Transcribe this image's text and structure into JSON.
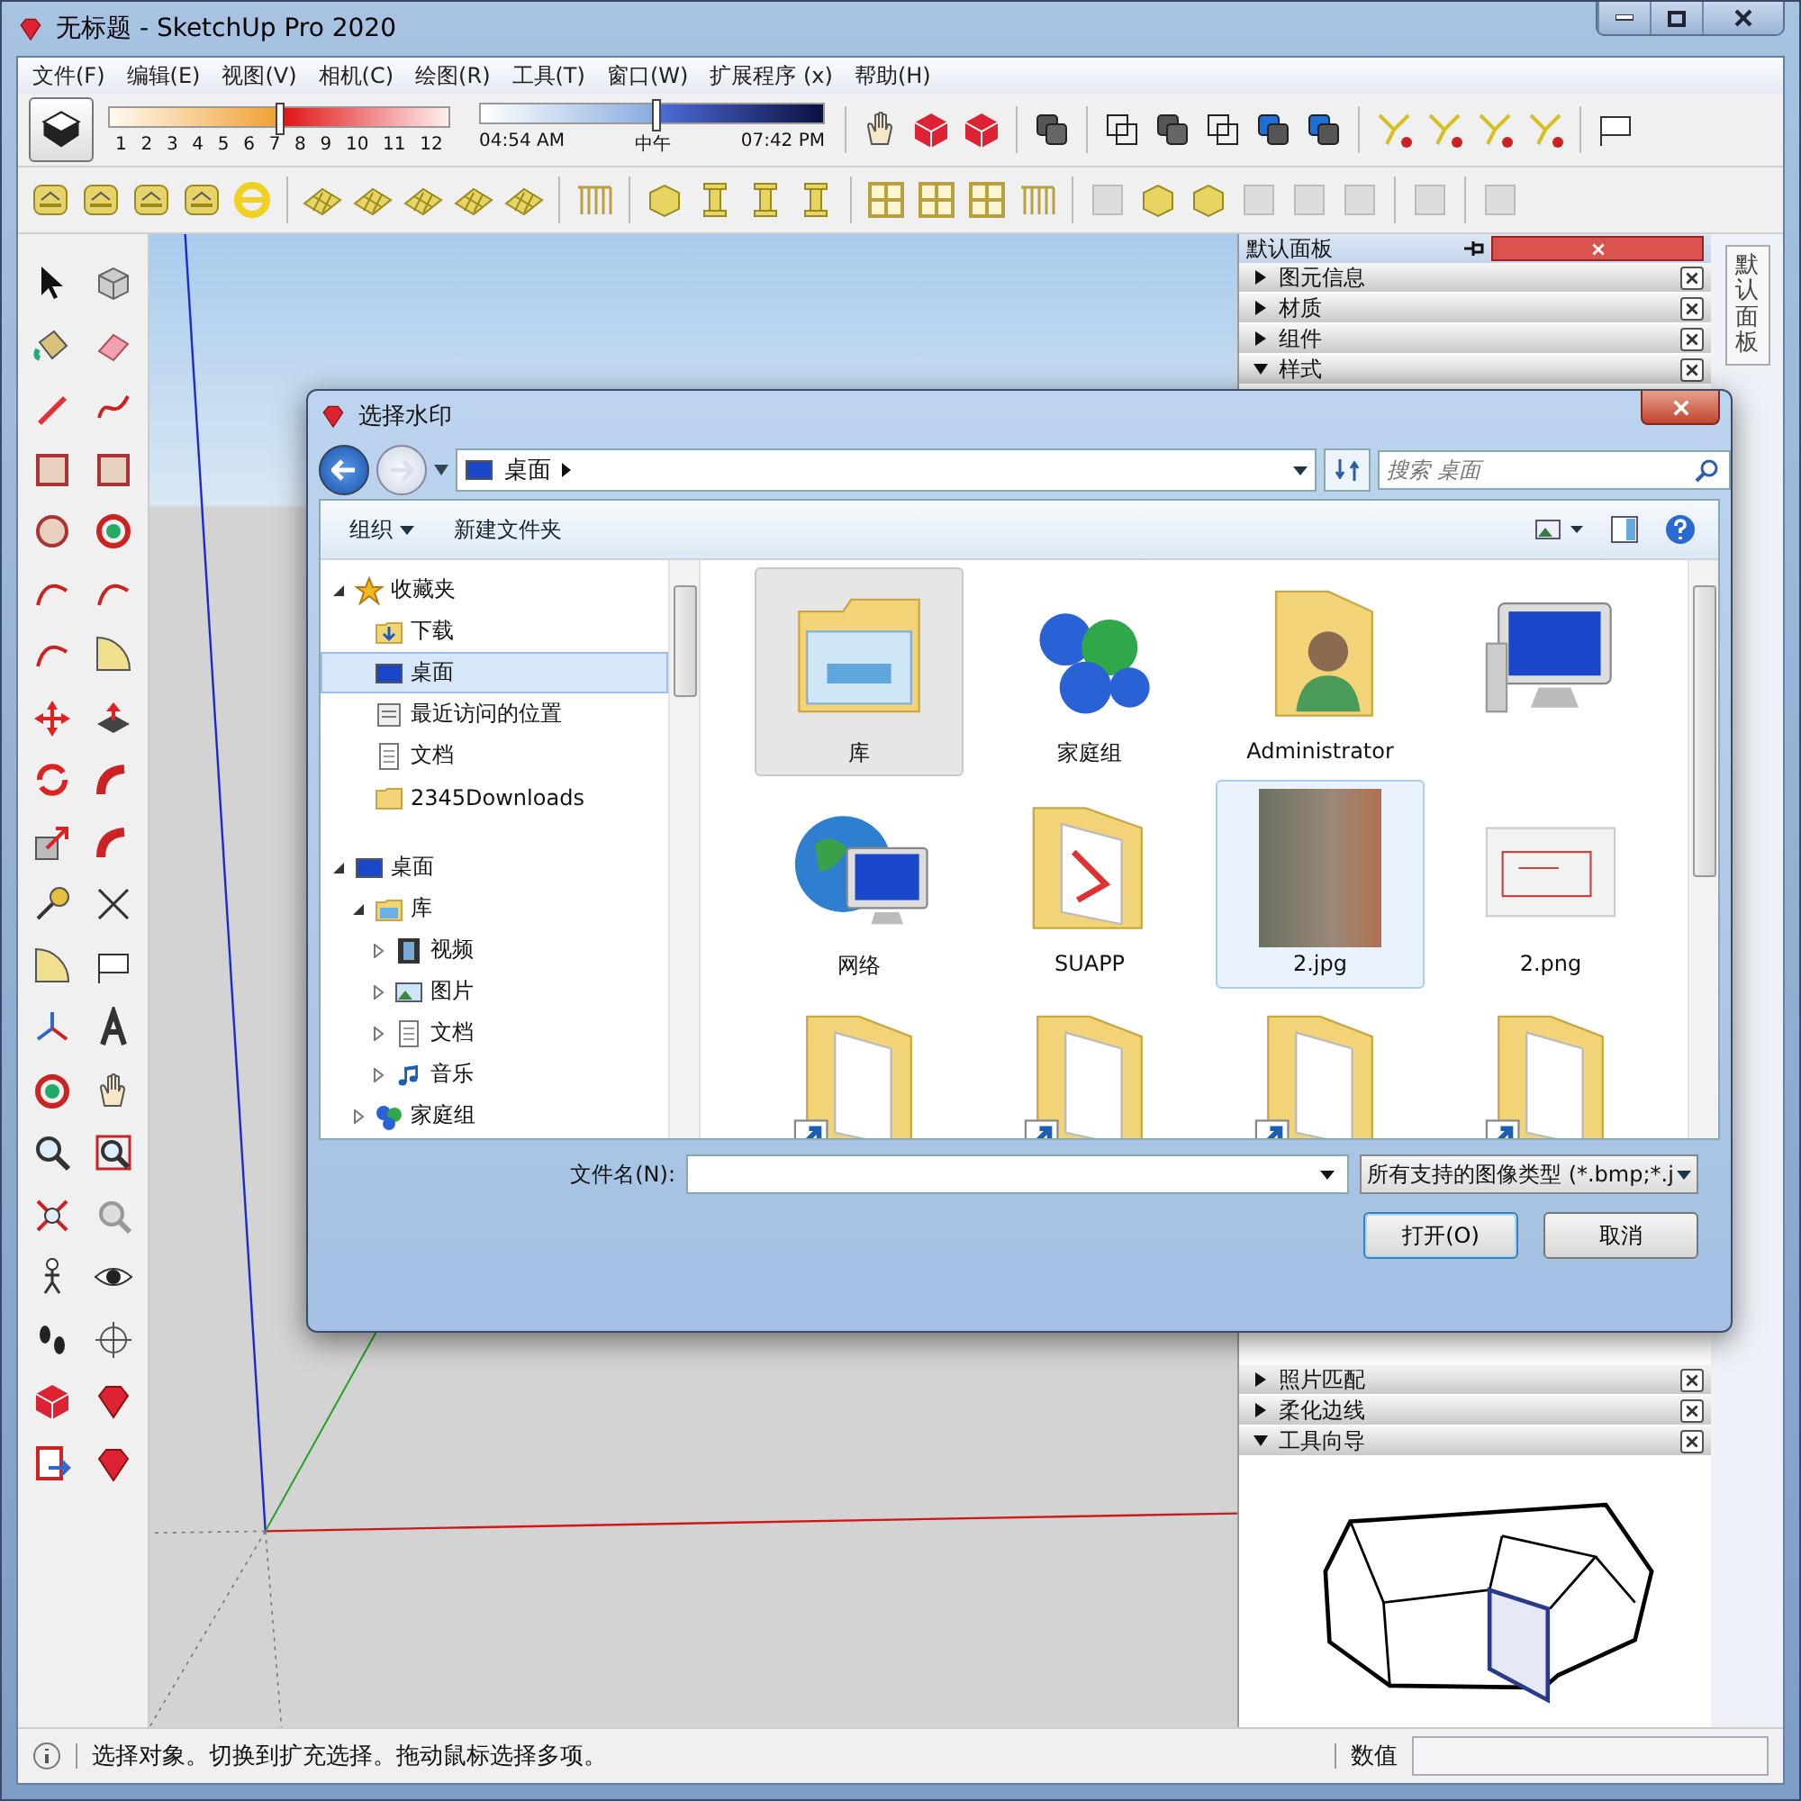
{
  "window": {
    "title": "无标题 - SketchUp Pro 2020"
  },
  "menu": [
    "文件(F)",
    "编辑(E)",
    "视图(V)",
    "相机(C)",
    "绘图(R)",
    "工具(T)",
    "窗口(W)",
    "扩展程序 (x)",
    "帮助(H)"
  ],
  "shadow_slider": {
    "ticks": [
      "1",
      "2",
      "3",
      "4",
      "5",
      "6",
      "7",
      "8",
      "9",
      "10",
      "11",
      "12"
    ],
    "level": 0.5
  },
  "time_slider": {
    "start": "04:54 AM",
    "middle": "中午",
    "end": "07:42 PM",
    "level": 0.51
  },
  "panel": {
    "title": "默认面板",
    "side_tab": "默认面板",
    "top_trays": [
      {
        "label": "图元信息",
        "expanded": false
      },
      {
        "label": "材质",
        "expanded": false
      },
      {
        "label": "组件",
        "expanded": false
      },
      {
        "label": "样式",
        "expanded": true
      }
    ],
    "bottom_trays": [
      {
        "label": "照片匹配",
        "expanded": false
      },
      {
        "label": "柔化边线",
        "expanded": false
      },
      {
        "label": "工具向导",
        "expanded": true
      }
    ]
  },
  "dialog": {
    "title": "选择水印",
    "location": "桌面",
    "search_placeholder": "搜索 桌面",
    "toolbar": [
      {
        "label": "组织",
        "kind": "menu"
      },
      {
        "label": "新建文件夹",
        "kind": "button"
      }
    ],
    "tree": [
      {
        "label": "收藏夹",
        "kind": "star",
        "expanded": true,
        "selected": false,
        "children": [
          {
            "label": "下载",
            "kind": "download",
            "selected": false
          },
          {
            "label": "桌面",
            "kind": "desktop",
            "selected": true
          },
          {
            "label": "最近访问的位置",
            "kind": "recent",
            "selected": false
          },
          {
            "label": "文档",
            "kind": "docs",
            "selected": false
          },
          {
            "label": "2345Downloads",
            "kind": "folder",
            "selected": false
          }
        ]
      },
      {
        "label": "桌面",
        "kind": "desktop",
        "expanded": true,
        "selected": false,
        "children": [
          {
            "label": "库",
            "kind": "library",
            "expanded": true,
            "selected": false,
            "children": [
              {
                "label": "视频",
                "kind": "video",
                "expanded": false,
                "selected": false
              },
              {
                "label": "图片",
                "kind": "picture",
                "expanded": false,
                "selected": false
              },
              {
                "label": "文档",
                "kind": "docs",
                "expanded": false,
                "selected": false
              },
              {
                "label": "音乐",
                "kind": "music",
                "expanded": false,
                "selected": false
              }
            ]
          },
          {
            "label": "家庭组",
            "kind": "homegroup",
            "expanded": false,
            "selected": false
          }
        ]
      }
    ],
    "files": [
      {
        "label": "库",
        "kind": "library",
        "selected": true,
        "hovered": false
      },
      {
        "label": "家庭组",
        "kind": "homegroup",
        "selected": false,
        "hovered": false
      },
      {
        "label": "Administrator",
        "kind": "user",
        "selected": false,
        "hovered": false
      },
      {
        "kind": "computer",
        "selected": false,
        "hovered": false
      },
      {
        "label": "网络",
        "kind": "network",
        "selected": false,
        "hovered": false
      },
      {
        "label": "SUAPP",
        "kind": "docfolder",
        "selected": false,
        "hovered": false
      },
      {
        "label": "2.jpg",
        "kind": "photo",
        "selected": false,
        "hovered": true
      },
      {
        "label": "2.png",
        "kind": "image",
        "selected": false,
        "hovered": false
      },
      {
        "kind": "shortcut",
        "selected": false,
        "hovered": false
      },
      {
        "kind": "shortcut",
        "selected": false,
        "hovered": false
      },
      {
        "kind": "shortcut",
        "selected": false,
        "hovered": false
      },
      {
        "kind": "shortcut",
        "selected": false,
        "hovered": false
      }
    ],
    "filename_label": "文件名(N):",
    "filter": "所有支持的图像类型 (*.bmp;*.j",
    "buttons": [
      "打开(O)",
      "取消"
    ]
  },
  "status_bar": {
    "message": "选择对象。切换到扩充选择。拖动鼠标选择多项。",
    "value_label": "数值"
  }
}
